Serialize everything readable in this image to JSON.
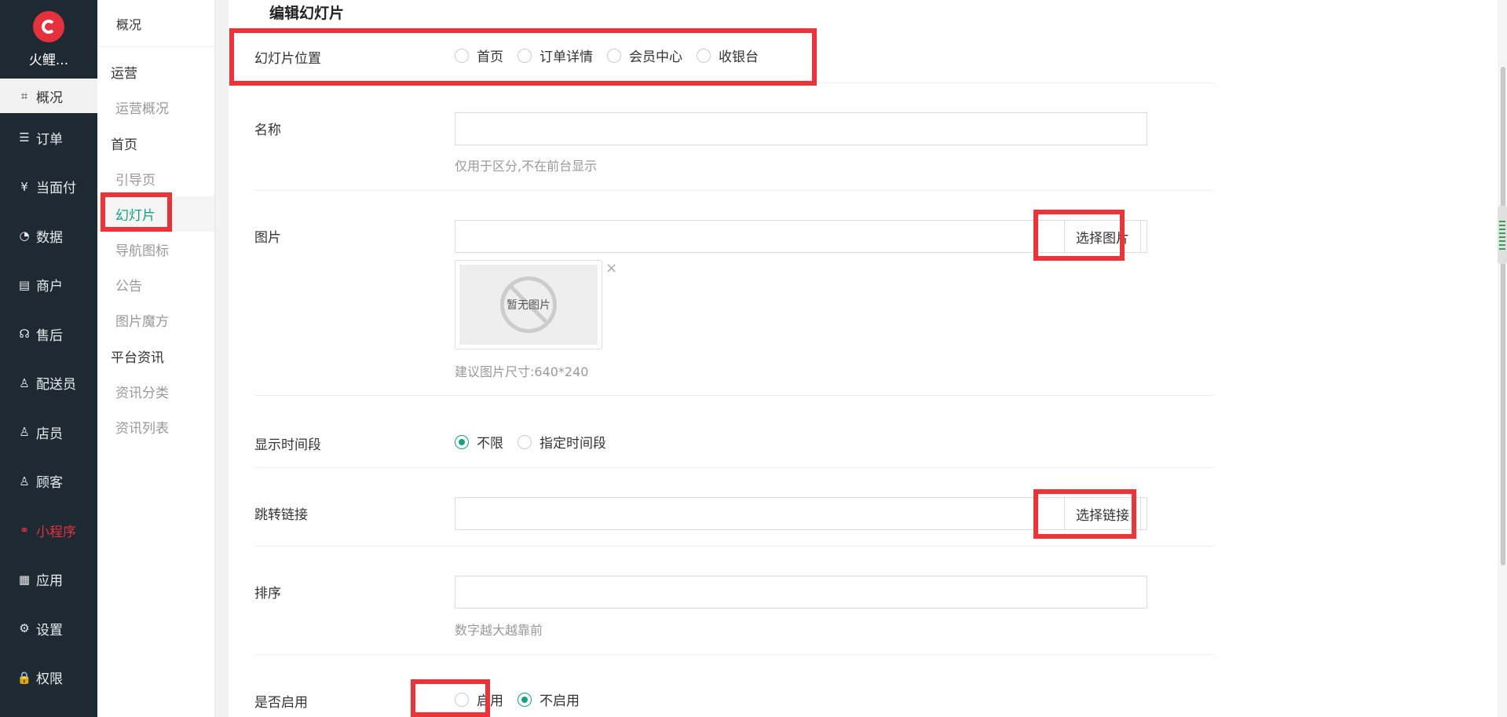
{
  "brand": {
    "name": "火鲤...",
    "accent": "#e6303c"
  },
  "nav": [
    {
      "label": "概况",
      "icon": "overview-icon",
      "glyph": "⌗"
    },
    {
      "label": "订单",
      "icon": "order-icon",
      "glyph": "☰"
    },
    {
      "label": "当面付",
      "icon": "pay-icon",
      "glyph": "¥"
    },
    {
      "label": "数据",
      "icon": "chart-icon",
      "glyph": "◔"
    },
    {
      "label": "商户",
      "icon": "store-icon",
      "glyph": "▤"
    },
    {
      "label": "售后",
      "icon": "service-icon",
      "glyph": "☊"
    },
    {
      "label": "配送员",
      "icon": "courier-icon",
      "glyph": "♙"
    },
    {
      "label": "店员",
      "icon": "clerk-icon",
      "glyph": "♙"
    },
    {
      "label": "顾客",
      "icon": "customer-icon",
      "glyph": "♙"
    },
    {
      "label": "小程序",
      "icon": "miniapp-icon",
      "glyph": "⚭"
    },
    {
      "label": "应用",
      "icon": "apps-icon",
      "glyph": "▦"
    },
    {
      "label": "设置",
      "icon": "gear-icon",
      "glyph": "⚙"
    },
    {
      "label": "权限",
      "icon": "lock-icon",
      "glyph": "🔒"
    }
  ],
  "subnav": {
    "top": "概况",
    "groups": [
      {
        "title": "运营",
        "links": [
          "运营概况"
        ]
      },
      {
        "title": "首页",
        "links": [
          "引导页",
          "幻灯片",
          "导航图标",
          "公告",
          "图片魔方"
        ]
      },
      {
        "title": "平台资讯",
        "links": [
          "资讯分类",
          "资讯列表"
        ]
      }
    ]
  },
  "form": {
    "title": "编辑幻灯片",
    "position": {
      "label": "幻灯片位置",
      "options": [
        "首页",
        "订单详情",
        "会员中心",
        "收银台"
      ]
    },
    "name": {
      "label": "名称",
      "value": "",
      "hint": "仅用于区分,不在前台显示"
    },
    "image": {
      "label": "图片",
      "value": "",
      "button": "选择图片",
      "placeholder": "暂无图片",
      "hint": "建议图片尺寸:640*240"
    },
    "display_time": {
      "label": "显示时间段",
      "options": [
        "不限",
        "指定时间段"
      ],
      "selected": "不限"
    },
    "link": {
      "label": "跳转链接",
      "value": "",
      "button": "选择链接"
    },
    "sort": {
      "label": "排序",
      "value": "",
      "hint": "数字越大越靠前"
    },
    "enabled": {
      "label": "是否启用",
      "options": [
        "启用",
        "不启用"
      ],
      "selected": "不启用"
    }
  },
  "colors": {
    "primary": "#14a383",
    "highlight": "#ee3237",
    "sidebar": "#1e2a33"
  }
}
